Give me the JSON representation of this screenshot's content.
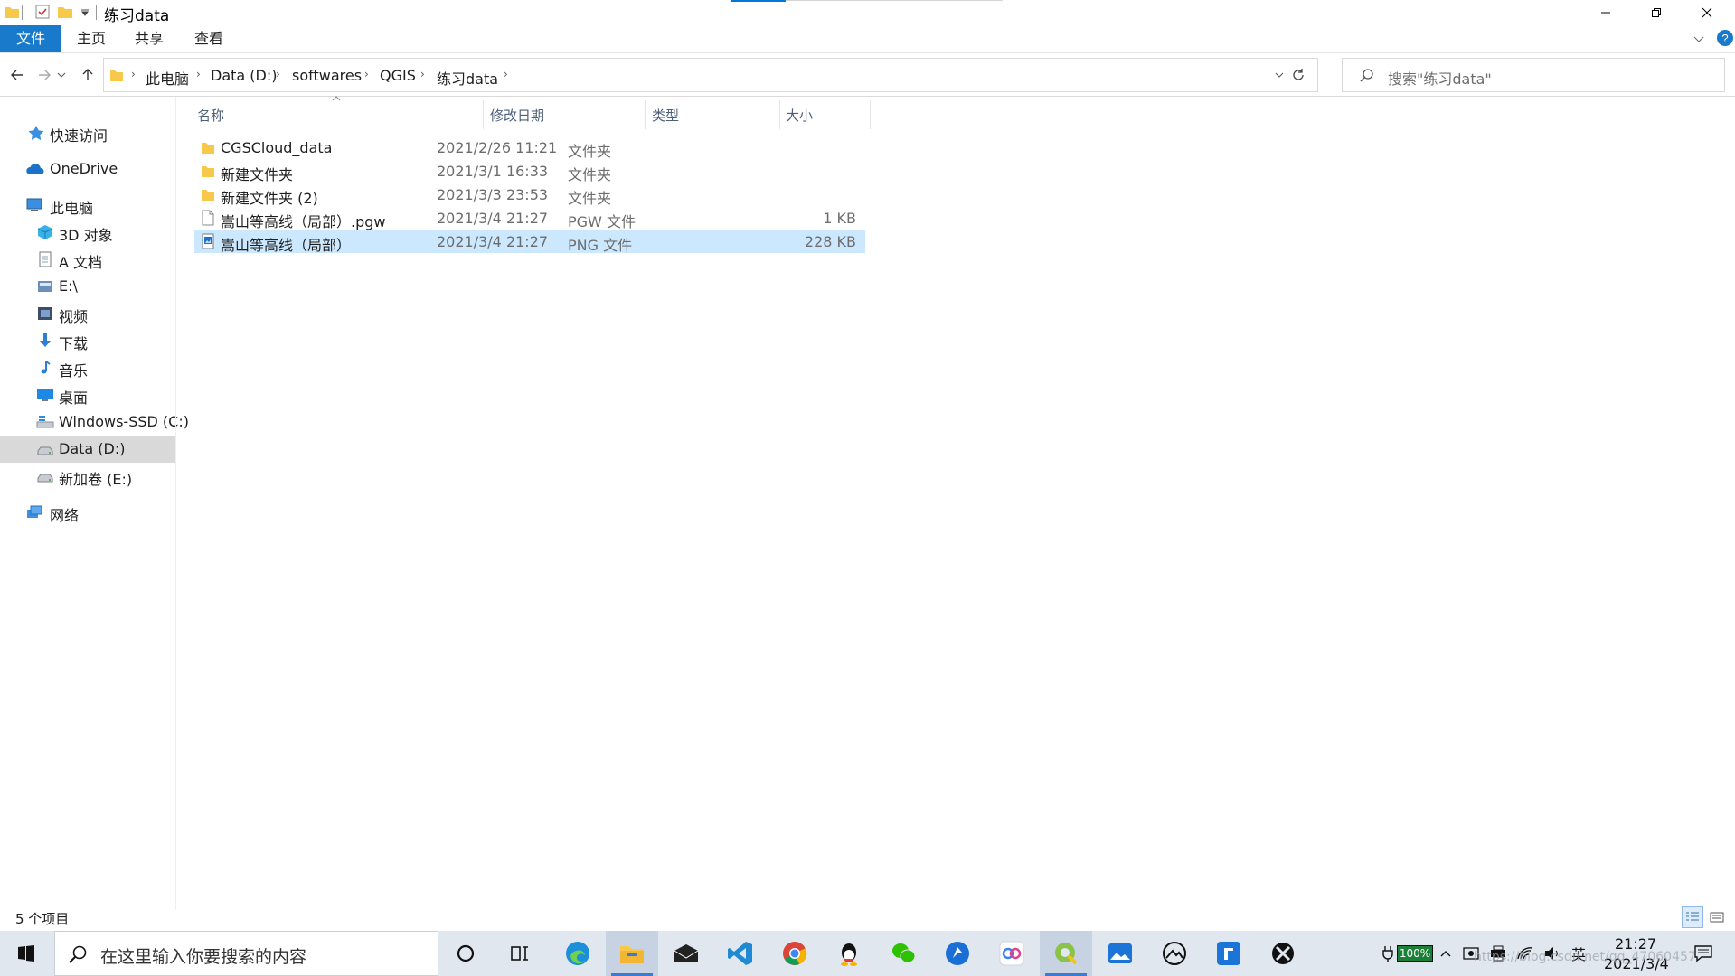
{
  "window": {
    "title": "练习data",
    "quick_access_toolbar": [
      "folder-icon",
      "properties-icon",
      "new-folder-icon",
      "customize-dropdown-icon"
    ],
    "controls": [
      "minimize",
      "restore",
      "close"
    ]
  },
  "ribbon": {
    "tabs": [
      {
        "label": "文件",
        "active": true
      },
      {
        "label": "主页"
      },
      {
        "label": "共享"
      },
      {
        "label": "查看"
      }
    ]
  },
  "address": {
    "breadcrumbs": [
      "此电脑",
      "Data (D:)",
      "softwares",
      "QGIS",
      "练习data"
    ],
    "search_placeholder": "搜索\"练习data\""
  },
  "sidebar": {
    "quick_access": "快速访问",
    "onedrive": "OneDrive",
    "this_pc": "此电脑",
    "items": [
      {
        "label": "3D 对象",
        "icon": "3d-objects-icon"
      },
      {
        "label": "A 文档",
        "icon": "documents-icon"
      },
      {
        "label": "E:\\",
        "icon": "drive-folder-icon"
      },
      {
        "label": "视频",
        "icon": "videos-icon"
      },
      {
        "label": "下载",
        "icon": "downloads-icon"
      },
      {
        "label": "音乐",
        "icon": "music-icon"
      },
      {
        "label": "桌面",
        "icon": "desktop-icon"
      },
      {
        "label": "Windows-SSD (C:)",
        "icon": "windows-drive-icon"
      },
      {
        "label": "Data (D:)",
        "icon": "drive-icon",
        "selected": true
      },
      {
        "label": "新加卷 (E:)",
        "icon": "drive-icon"
      }
    ],
    "network": "网络"
  },
  "filelist": {
    "columns": {
      "name": "名称",
      "date": "修改日期",
      "type": "类型",
      "size": "大小"
    },
    "rows": [
      {
        "name": "CGSCloud_data",
        "date": "2021/2/26 11:21",
        "type": "文件夹",
        "size": "",
        "icon": "folder-icon"
      },
      {
        "name": "新建文件夹",
        "date": "2021/3/1 16:33",
        "type": "文件夹",
        "size": "",
        "icon": "folder-icon"
      },
      {
        "name": "新建文件夹 (2)",
        "date": "2021/3/3 23:53",
        "type": "文件夹",
        "size": "",
        "icon": "folder-icon"
      },
      {
        "name": "嵩山等高线（局部）.pgw",
        "date": "2021/3/4 21:27",
        "type": "PGW 文件",
        "size": "1 KB",
        "icon": "file-icon"
      },
      {
        "name": "嵩山等高线（局部）",
        "date": "2021/3/4 21:27",
        "type": "PNG 文件",
        "size": "228 KB",
        "icon": "image-file-icon",
        "selected": true
      }
    ]
  },
  "status": {
    "count": "5 个项目"
  },
  "taskbar": {
    "search_text": "在这里输入你要搜索的内容",
    "apps": [
      "cortana-icon",
      "task-view-icon",
      "edge-icon",
      "file-explorer-icon",
      "mail-icon",
      "vscode-icon",
      "chrome-icon",
      "qq-icon",
      "wechat-icon",
      "feishu-icon",
      "baidu-netdisk-icon",
      "qgis-icon",
      "photos-icon",
      "steam-icon",
      "teams-icon",
      "xbox-icon"
    ],
    "battery": "100%",
    "ime": "英",
    "time": "21:27",
    "date": "2021/3/4",
    "watermark": "https://blog.csdn.net/qq_47060457"
  }
}
